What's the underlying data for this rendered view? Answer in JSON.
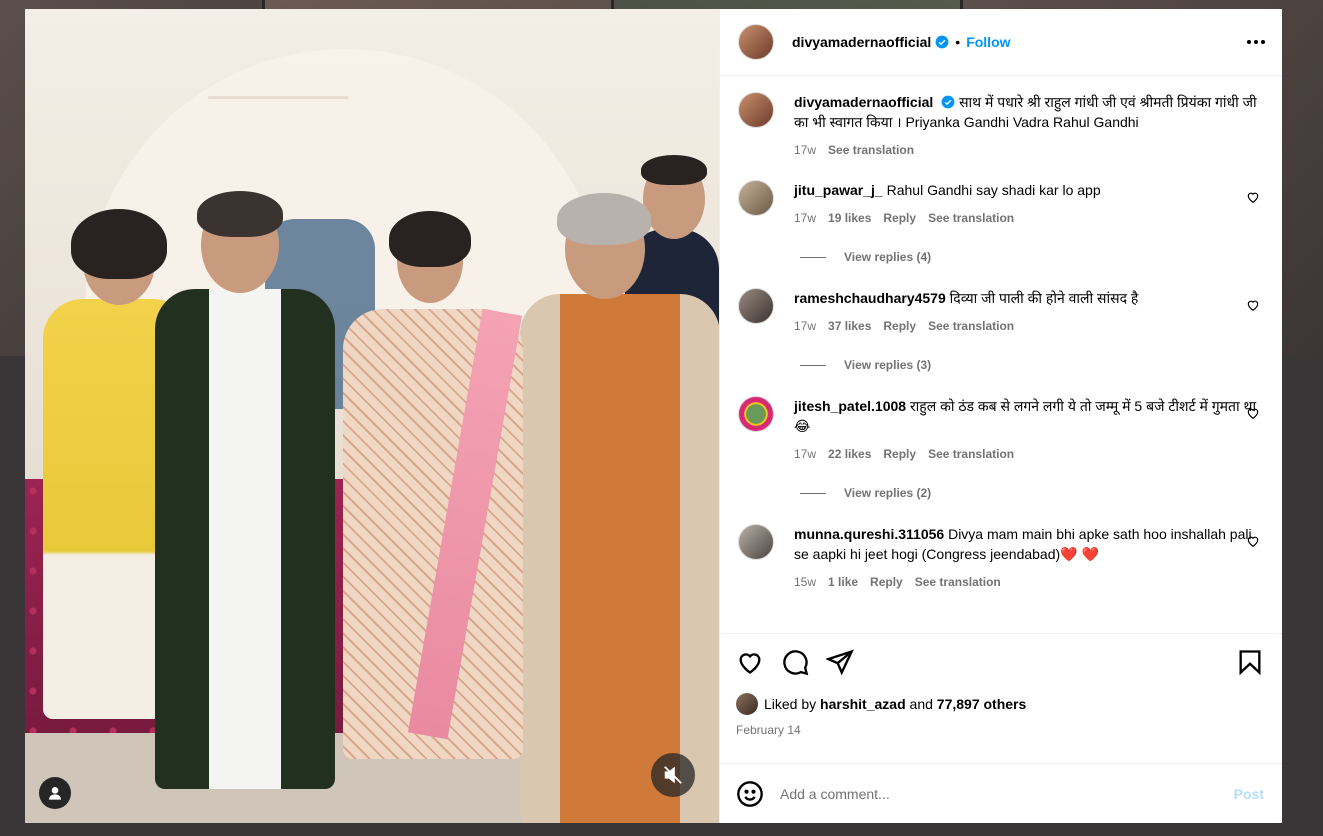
{
  "header": {
    "username": "divyamadernaofficial",
    "separator": "•",
    "follow_label": "Follow"
  },
  "caption": {
    "username": "divyamadernaofficial",
    "text": "साथ में पधारे श्री राहुल गांधी जी एवं श्रीमती प्रियंका गांधी जी का भी स्वागत किया । Priyanka Gandhi Vadra Rahul Gandhi",
    "time": "17w",
    "see_translation": "See translation"
  },
  "comments": [
    {
      "username": "jitu_pawar_j_",
      "text": "Rahul Gandhi say shadi kar lo app",
      "time": "17w",
      "likes": "19 likes",
      "reply": "Reply",
      "see_translation": "See translation",
      "view_replies": "View replies (4)"
    },
    {
      "username": "rameshchaudhary4579",
      "text": "दिव्या जी पाली की होने वाली सांसद है",
      "time": "17w",
      "likes": "37 likes",
      "reply": "Reply",
      "see_translation": "See translation",
      "view_replies": "View replies (3)"
    },
    {
      "username": "jitesh_patel.1008",
      "text": "राहुल को ठंड कब से लगने लगी ये तो जम्मू में 5 बजे टीशर्ट में गुमता था 😂",
      "time": "17w",
      "likes": "22 likes",
      "reply": "Reply",
      "see_translation": "See translation",
      "view_replies": "View replies (2)"
    },
    {
      "username": "munna.qureshi.311056",
      "text": "Divya mam main bhi apke sath hoo inshallah pali se aapki hi jeet hogi (Congress jeendabad)❤️ ❤️",
      "time": "15w",
      "likes": "1 like",
      "reply": "Reply",
      "see_translation": "See translation"
    }
  ],
  "likes": {
    "prefix": "Liked by",
    "user": "harshit_azad",
    "and": "and",
    "others": "77,897 others"
  },
  "date": "February 14",
  "add_comment": {
    "placeholder": "Add a comment...",
    "post_label": "Post"
  },
  "colors": {
    "accent": "#0095f6",
    "muted": "#737373",
    "post_disabled": "#b2dffc"
  },
  "icons": [
    "verified-badge-icon",
    "more-options-icon",
    "heart-icon",
    "comment-icon",
    "share-icon",
    "bookmark-icon",
    "emoji-icon",
    "user-tag-icon",
    "mute-icon"
  ]
}
